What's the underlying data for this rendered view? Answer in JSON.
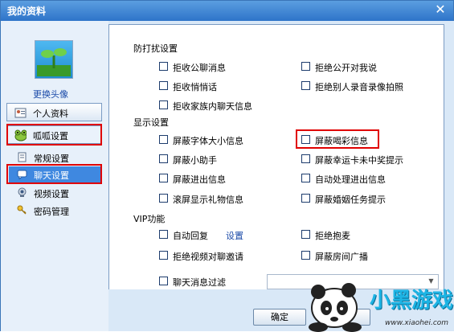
{
  "window": {
    "title": "我的资料",
    "close_icon": "close-icon"
  },
  "sidebar": {
    "change_avatar": "更换头像",
    "items": [
      {
        "label": "个人资料",
        "icon": "profile-card-icon"
      },
      {
        "label": "呱呱设置",
        "icon": "frog-icon"
      },
      {
        "label": "常规设置",
        "icon": "document-icon"
      },
      {
        "label": "聊天设置",
        "icon": "chat-icon"
      },
      {
        "label": "视频设置",
        "icon": "webcam-icon"
      },
      {
        "label": "密码管理",
        "icon": "key-icon"
      }
    ]
  },
  "sections": {
    "anti_disturb": {
      "title": "防打扰设置",
      "options": [
        "拒收公聊消息",
        "拒绝公开对我说",
        "拒收悄悄话",
        "拒绝别人录音录像拍照",
        "拒收家族内聊天信息"
      ]
    },
    "display": {
      "title": "显示设置",
      "options": [
        "屏蔽字体大小信息",
        "屏蔽喝彩信息",
        "屏蔽小助手",
        "屏蔽幸运卡未中奖提示",
        "屏蔽进出信息",
        "自动处理进出信息",
        "滚屏显示礼物信息",
        "屏蔽婚姻任务提示"
      ]
    },
    "vip": {
      "title": "VIP功能",
      "options": [
        "自动回复",
        "拒绝抱麦",
        "拒绝视频对聊邀请",
        "屏蔽房间广播",
        "聊天消息过滤"
      ],
      "settings_link": "设置",
      "filter_value": ""
    }
  },
  "buttons": {
    "ok": "确定",
    "cancel": "消"
  },
  "watermark": {
    "text": "小黑游戏",
    "url": "www.xiaohei.com"
  },
  "colors": {
    "highlight_red": "#e00000",
    "selected_blue": "#3f88e0",
    "link_blue": "#1a4aa8"
  }
}
